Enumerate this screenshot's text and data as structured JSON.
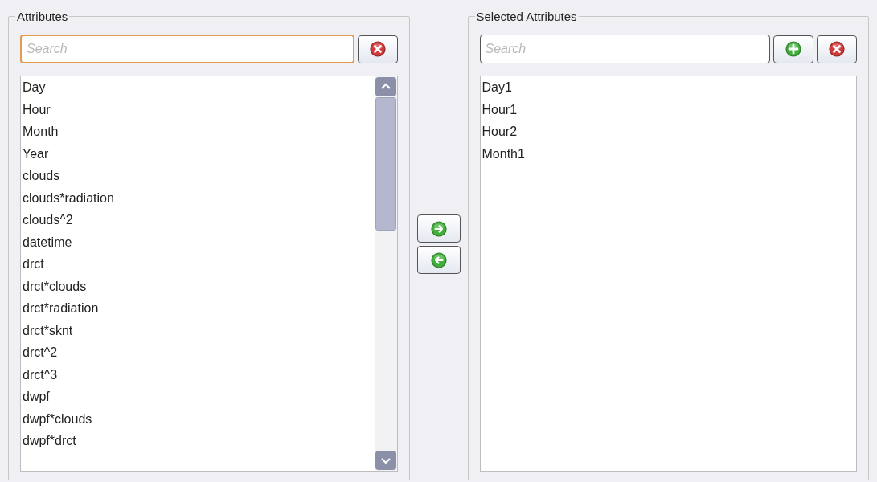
{
  "available": {
    "title": "Attributes",
    "search": {
      "placeholder": "Search",
      "focused": true
    },
    "items": [
      "Day",
      "Hour",
      "Month",
      "Year",
      "clouds",
      "clouds*radiation",
      "clouds^2",
      "datetime",
      "drct",
      "drct*clouds",
      "drct*radiation",
      "drct*sknt",
      "drct^2",
      "drct^3",
      "dwpf",
      "dwpf*clouds",
      "dwpf*drct"
    ]
  },
  "selected": {
    "title": "Selected Attributes",
    "search": {
      "placeholder": "Search",
      "focused": false
    },
    "items": [
      "Day1",
      "Hour1",
      "Hour2",
      "Month1"
    ]
  }
}
